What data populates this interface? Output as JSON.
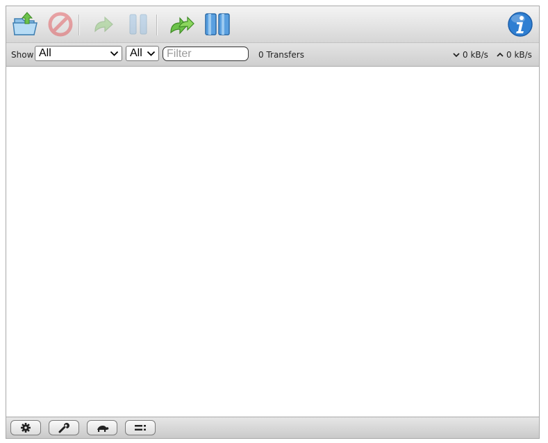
{
  "toolbar": {
    "buttons": [
      {
        "name": "open-torrent-button",
        "icon": "open-folder-icon",
        "enabled": true
      },
      {
        "name": "remove-torrent-button",
        "icon": "remove-icon",
        "enabled": false
      },
      {
        "name": "resume-torrent-button",
        "icon": "resume-arrow-icon",
        "enabled": false
      },
      {
        "name": "pause-torrent-button",
        "icon": "pause-icon",
        "enabled": false
      },
      {
        "name": "resume-all-button",
        "icon": "resume-all-icon",
        "enabled": true
      },
      {
        "name": "pause-all-button",
        "icon": "pause-all-icon",
        "enabled": true
      },
      {
        "name": "about-button",
        "icon": "info-icon",
        "enabled": true
      }
    ],
    "colors": {
      "accent_blue": "#2f7fd2",
      "green": "#5aa32a",
      "red": "#d9534f"
    }
  },
  "filterbar": {
    "show_label": "Show",
    "state_select": {
      "value": "All"
    },
    "tracker_select": {
      "value": "All"
    },
    "filter_placeholder": "Filter",
    "transfers_count": "0 Transfers",
    "download_speed": "0 kB/s",
    "upload_speed": "0 kB/s"
  },
  "bottombar": {
    "buttons": [
      {
        "name": "settings-button",
        "icon": "gear-icon"
      },
      {
        "name": "preferences-button",
        "icon": "wrench-icon"
      },
      {
        "name": "turtle-mode-button",
        "icon": "turtle-icon"
      },
      {
        "name": "compact-view-button",
        "icon": "compact-view-icon"
      }
    ]
  }
}
